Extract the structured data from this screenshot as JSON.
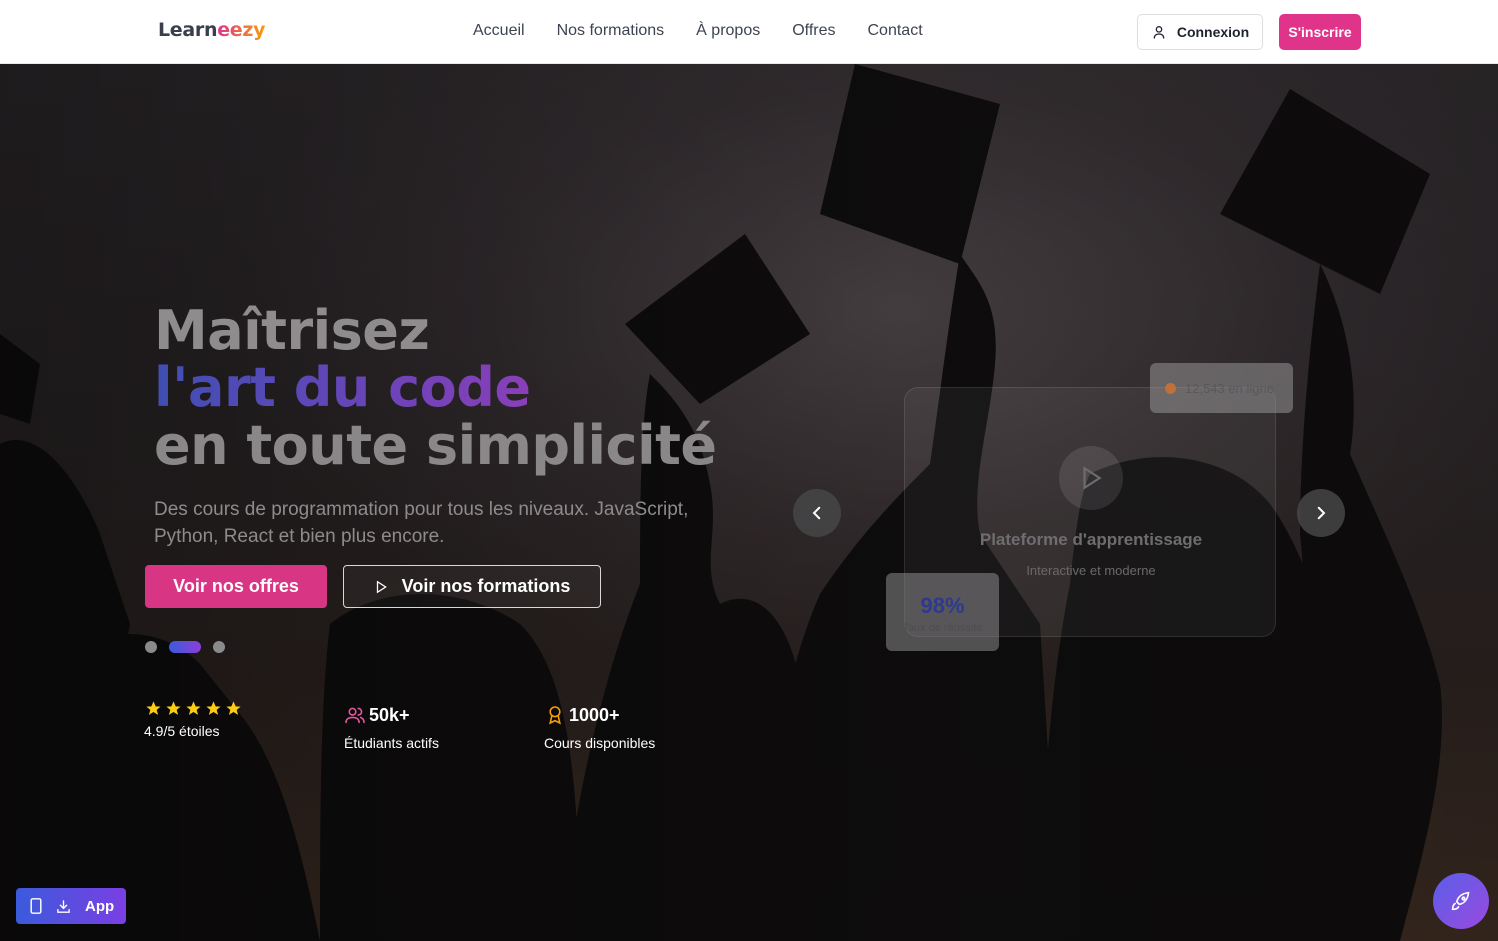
{
  "nav": {
    "logo_main": "Learn",
    "logo_accent": "eezy",
    "links": [
      {
        "label": "Accueil"
      },
      {
        "label": "Nos formations"
      },
      {
        "label": "À propos"
      },
      {
        "label": "Offres"
      },
      {
        "label": "Contact"
      }
    ],
    "login_label": "Connexion",
    "signup_label": "S'inscrire"
  },
  "hero": {
    "title_line1": "Maîtrisez",
    "title_line2": "l'art du code",
    "title_line3": "en toute simplicité",
    "subtitle": "Des cours de programmation pour tous les niveaux. JavaScript, Python, React et bien plus encore.",
    "primary_cta": "Voir nos offres",
    "secondary_cta": "Voir nos formations",
    "slides_total": 3,
    "active_slide": 2
  },
  "stats": {
    "rating_stars": 5,
    "rating_label": "4.9/5 étoiles",
    "students_value": "50k+",
    "students_label": "Étudiants actifs",
    "courses_value": "1000+",
    "courses_label": "Cours disponibles"
  },
  "showcase": {
    "card_title": "Plateforme d'apprentissage",
    "card_subtitle": "Interactive et moderne",
    "online_text": "12,543 en ligne",
    "success_rate": "98%",
    "success_label": "Taux de réussite"
  },
  "floating": {
    "app_label": "App"
  },
  "colors": {
    "brand_pink": "#e0348b",
    "gradient_blue": "#3b5bdb",
    "gradient_purple": "#8b3fd9",
    "star_yellow": "#facc15"
  }
}
